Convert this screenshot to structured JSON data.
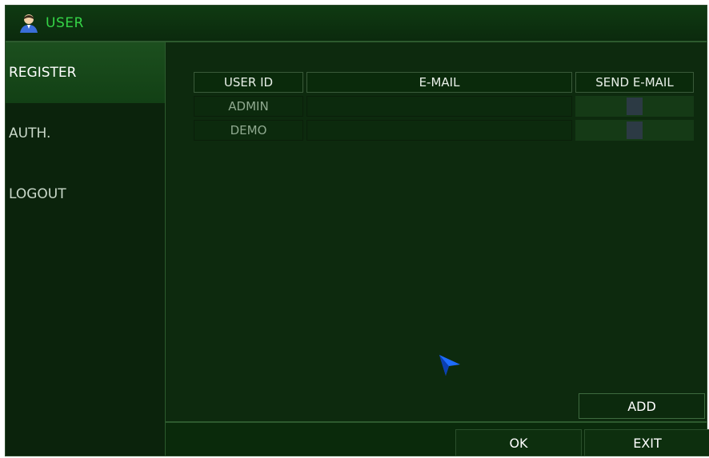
{
  "window": {
    "title": "USER"
  },
  "sidebar": {
    "items": [
      {
        "label": "REGISTER",
        "active": true
      },
      {
        "label": "AUTH.",
        "active": false
      },
      {
        "label": "LOGOUT",
        "active": false
      }
    ]
  },
  "table": {
    "headers": [
      "USER ID",
      "E-MAIL",
      "SEND E-MAIL"
    ],
    "rows": [
      {
        "user_id": "ADMIN",
        "email": "",
        "send_email": false
      },
      {
        "user_id": "DEMO",
        "email": "",
        "send_email": false
      }
    ]
  },
  "buttons": {
    "add": "ADD",
    "ok": "OK",
    "exit": "EXIT"
  },
  "colors": {
    "accent": "#35d447",
    "background": "#0d2a0e",
    "active_item": "#1c4f1e"
  },
  "icons": {
    "title": "user-icon",
    "pointer": "cursor-arrow-icon"
  }
}
